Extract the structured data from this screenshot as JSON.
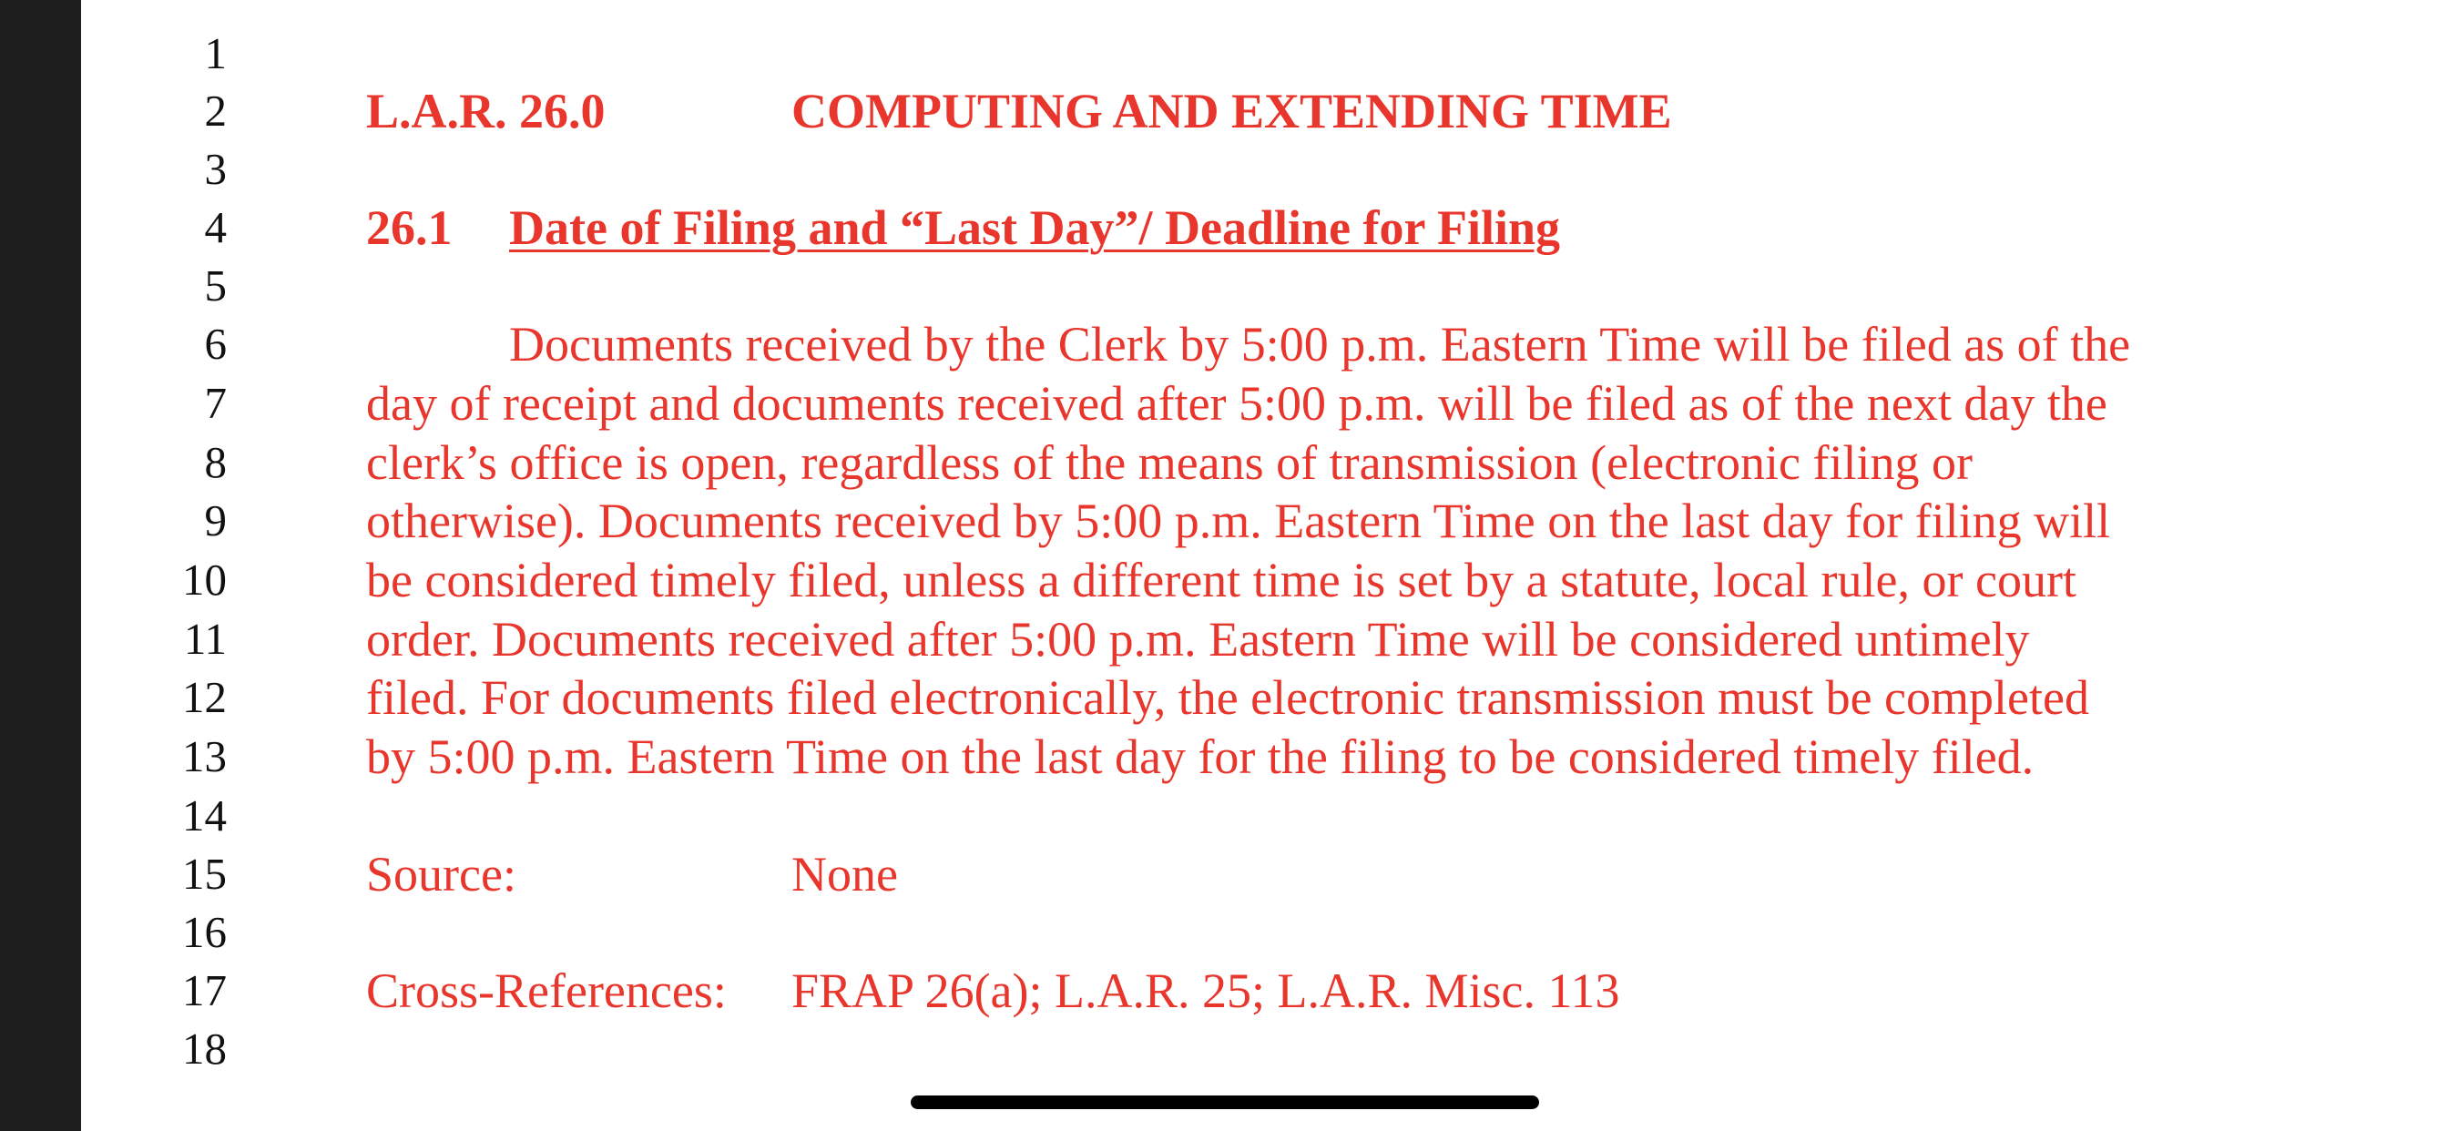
{
  "line_numbers": [
    "1",
    "2",
    "3",
    "4",
    "5",
    "6",
    "7",
    "8",
    "9",
    "10",
    "11",
    "12",
    "13",
    "14",
    "15",
    "16",
    "17",
    "18"
  ],
  "rule": {
    "number": "L.A.R. 26.0",
    "title": "COMPUTING AND EXTENDING TIME"
  },
  "section": {
    "number": "26.1",
    "title": "Date of Filing and “Last Day”/ Deadline for Filing"
  },
  "body_lines": [
    "Documents received by the Clerk by 5:00 p.m. Eastern Time will be filed as of the",
    "day of receipt and documents received after 5:00 p.m. will be filed as of the next day the",
    "clerk’s office is open, regardless of the means of transmission (electronic filing or",
    "otherwise).  Documents received by 5:00 p.m. Eastern Time on the last day for filing will",
    "be considered timely filed, unless a different time is set by a statute, local rule, or court",
    "order.  Documents received after 5:00 p.m. Eastern Time will be considered untimely",
    "filed.  For documents filed electronically, the electronic transmission must be completed",
    "by 5:00 p.m. Eastern Time on the last day for the filing to be considered timely filed."
  ],
  "source": {
    "label": "Source:",
    "value": "None"
  },
  "cross_references": {
    "label": "Cross-References:",
    "value": "FRAP 26(a); L.A.R. 25; L.A.R. Misc. 113"
  }
}
